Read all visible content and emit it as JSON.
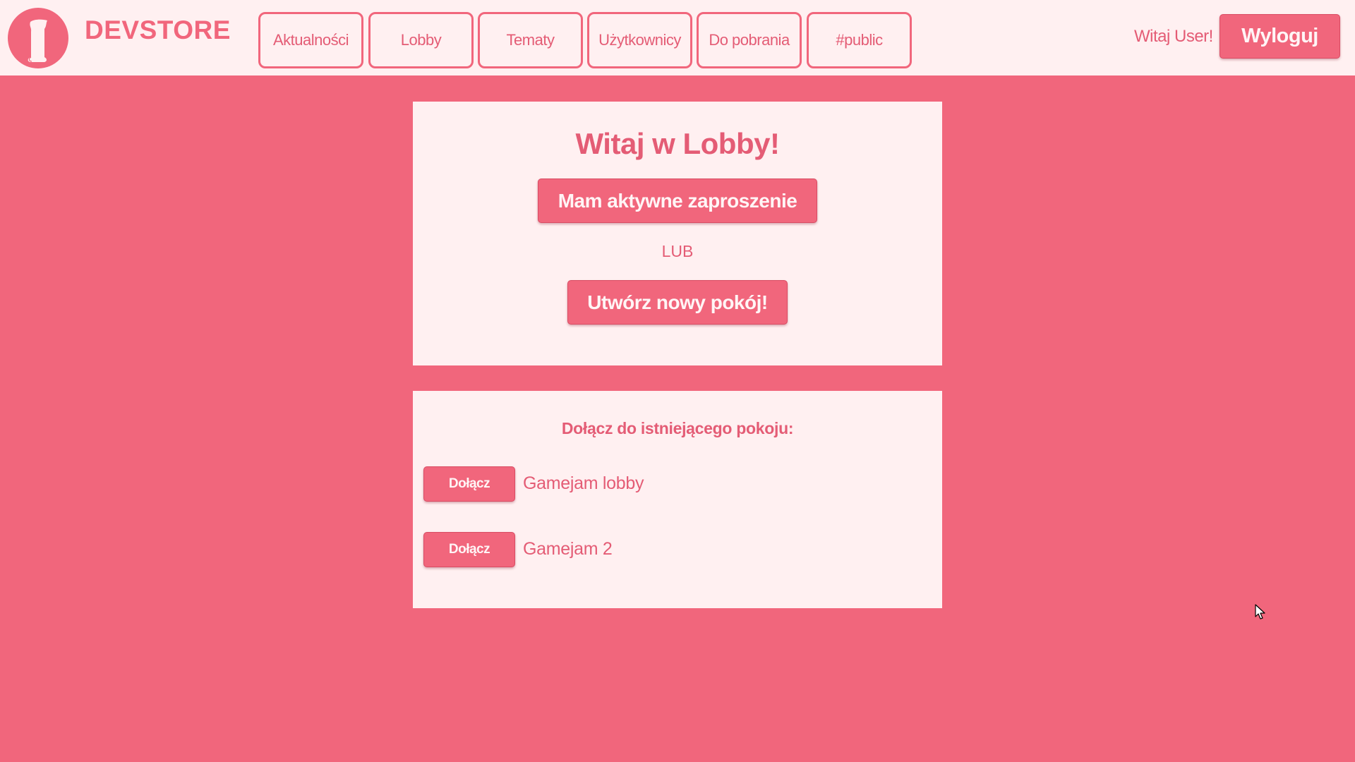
{
  "header": {
    "brand": "DEVSTORE",
    "nav": [
      {
        "label": "Aktualności"
      },
      {
        "label": "Lobby"
      },
      {
        "label": "Tematy"
      },
      {
        "label": "Użytkownicy"
      },
      {
        "label": "Do pobrania"
      },
      {
        "label": "#public"
      }
    ],
    "greeting": "Witaj User!",
    "logout_label": "Wyloguj"
  },
  "lobby": {
    "title": "Witaj w Lobby!",
    "invite_label": "Mam aktywne zaproszenie",
    "or_label": "LUB",
    "create_label": "Utwórz nowy pokój!"
  },
  "rooms": {
    "title": "Dołącz do istniejącego pokoju:",
    "items": [
      {
        "join_label": "Dołącz",
        "name": "Gamejam lobby"
      },
      {
        "join_label": "Dołącz",
        "name": "Gamejam 2"
      }
    ]
  },
  "colors": {
    "accent": "#f1667c",
    "panel_bg": "#fff0f1",
    "text": "#e45c75"
  },
  "icons": {
    "logo": "scroll-logo-icon",
    "cursor": "mouse-pointer-icon"
  }
}
